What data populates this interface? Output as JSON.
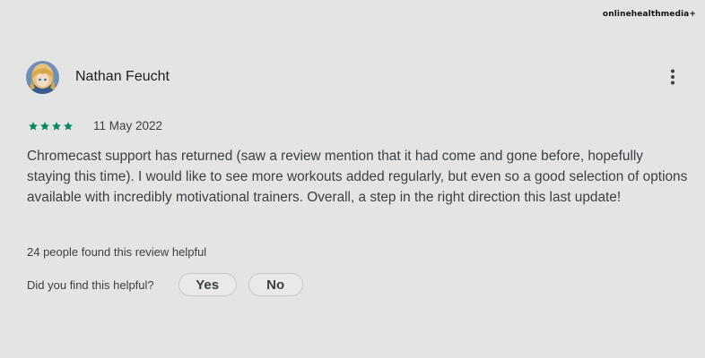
{
  "watermark": "onlinehealthmedia+",
  "review": {
    "reviewer_name": "Nathan Feucht",
    "rating": 4,
    "rating_max": 5,
    "date": "11 May 2022",
    "text": "Chromecast support has returned (saw a review mention that it had come and gone before, hopefully staying this time). I would like to see more workouts added regularly, but even so a good selection of options available with incredibly motivational trainers. Overall, a step in the right direction this last update!",
    "helpful_count_text": "24 people found this review helpful"
  },
  "feedback": {
    "question": "Did you find this helpful?",
    "yes_label": "Yes",
    "no_label": "No"
  },
  "icons": {
    "more": "more-vert-icon",
    "star": "star-icon",
    "avatar": "avatar-image"
  },
  "colors": {
    "background": "#e4e4e4",
    "star": "#01875f",
    "text": "#3c4043"
  }
}
